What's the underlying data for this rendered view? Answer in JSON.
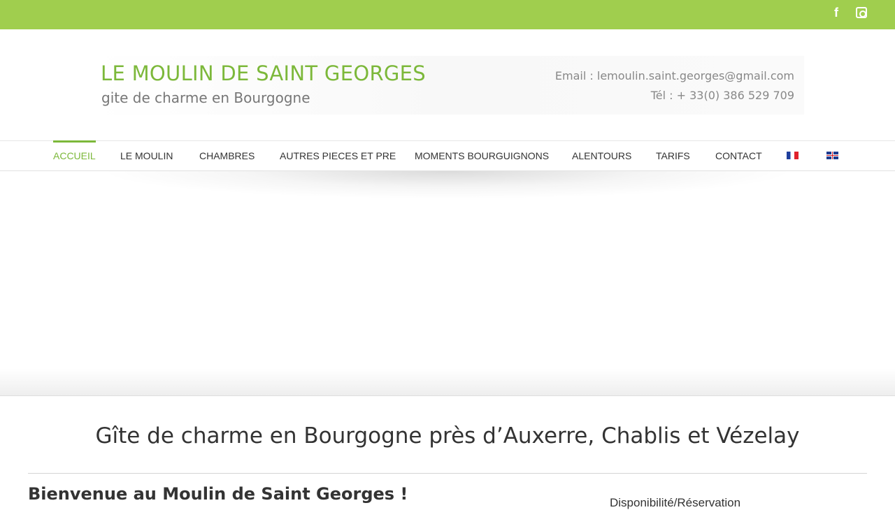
{
  "social": {
    "facebook_icon": "facebook-icon",
    "instagram_icon": "instagram-icon",
    "facebook_glyph": "f"
  },
  "header": {
    "site_title": "LE MOULIN DE SAINT GEORGES",
    "tagline": "gite de charme en Bourgogne",
    "email": "Email : lemoulin.saint.georges@gmail.com",
    "phone": "Tél : + 33(0) 386 529 709"
  },
  "nav": {
    "items": [
      {
        "label": "ACCUEIL",
        "active": true
      },
      {
        "label": "LE MOULIN"
      },
      {
        "label": "CHAMBRES"
      },
      {
        "label": "AUTRES PIECES ET PRE"
      },
      {
        "label": "MOMENTS BOURGUIGNONS"
      },
      {
        "label": "ALENTOURS"
      },
      {
        "label": "TARIFS"
      },
      {
        "label": "CONTACT"
      }
    ],
    "languages": [
      "flag-fr-icon",
      "flag-uk-icon"
    ]
  },
  "content": {
    "heading": "Gîte de charme en Bourgogne près d’Auxerre, Chablis et Vézelay",
    "welcome": "Bienvenue au Moulin de Saint Georges !",
    "side_heading": "Disponibilité/Réservation"
  },
  "colors": {
    "accent": "#a0ce4e",
    "brand_green": "#7cb83a",
    "text": "#333333"
  }
}
